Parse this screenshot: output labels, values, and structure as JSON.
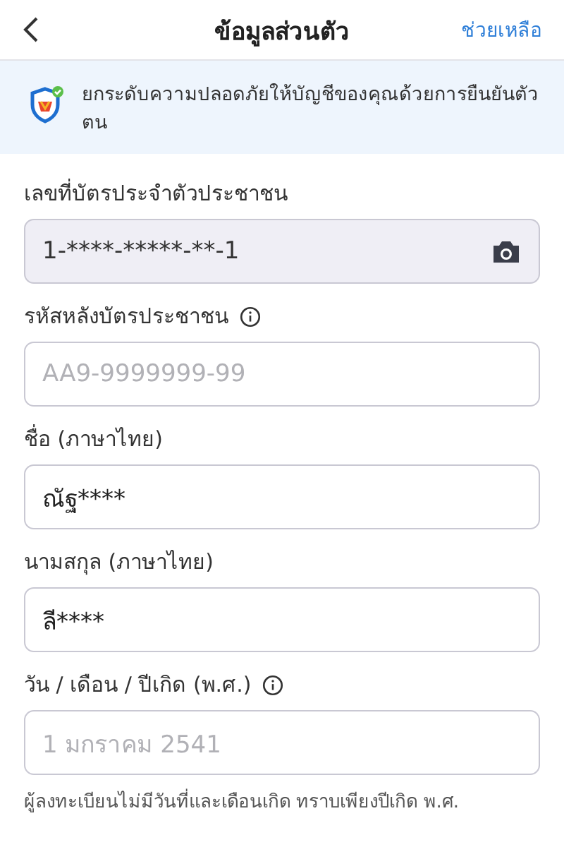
{
  "header": {
    "title": "ข้อมูลส่วนตัว",
    "help": "ช่วยเหลือ"
  },
  "banner": {
    "text": "ยกระดับความปลอดภัยให้บัญชีของคุณด้วยการยืนยันตัวตน"
  },
  "fields": [
    {
      "label": "เลขที่บัตรประจำตัวประชาชน",
      "info": false,
      "value": "1-****-*****-**-1",
      "disabled": true,
      "kind": "scan"
    },
    {
      "label": "รหัสหลังบัตรประชาชน",
      "info": true,
      "placeholder": "AA9-9999999-99",
      "disabled": false
    },
    {
      "label": "ชื่อ (ภาษาไทย)",
      "info": false,
      "value": "ณัฐ****",
      "disabled": false
    },
    {
      "label": "นามสกุล (ภาษาไทย)",
      "info": false,
      "value": "ลี****",
      "disabled": false
    },
    {
      "label": "วัน / เดือน / ปีเกิด (พ.ศ.)",
      "info": true,
      "placeholder": "1 มกราคม 2541",
      "disabled": false
    }
  ],
  "note": "ผู้ลงทะเบียนไม่มีวันที่และเดือนเกิด ทราบเพียงปีเกิด พ.ศ."
}
